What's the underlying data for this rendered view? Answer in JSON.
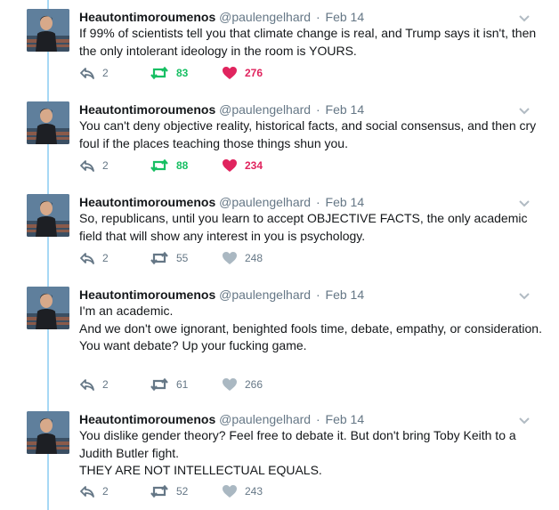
{
  "colors": {
    "thread_line": "#a7d8f5",
    "retweet_active": "#17bf63",
    "like_active": "#e0245e",
    "muted": "#657786"
  },
  "tweets": [
    {
      "name": "Heautontimoroumenos",
      "handle": "@paulengelhard",
      "sep": "·",
      "date": "Feb 14",
      "lines": [
        "If 99% of scientists tell you that climate change is real, and Trump says it isn't, then the only intolerant ideology in the room is YOURS."
      ],
      "replies": "2",
      "retweets": "83",
      "likes": "276",
      "retweeted": true,
      "liked": true
    },
    {
      "name": "Heautontimoroumenos",
      "handle": "@paulengelhard",
      "sep": "·",
      "date": "Feb 14",
      "lines": [
        "You can't deny objective reality, historical facts, and social consensus, and then cry foul if the places teaching those things shun you."
      ],
      "replies": "2",
      "retweets": "88",
      "likes": "234",
      "retweeted": true,
      "liked": true
    },
    {
      "name": "Heautontimoroumenos",
      "handle": "@paulengelhard",
      "sep": "·",
      "date": "Feb 14",
      "lines": [
        "So, republicans, until you learn to accept OBJECTIVE FACTS, the only academic field that will show any interest in you is psychology."
      ],
      "replies": "2",
      "retweets": "55",
      "likes": "248",
      "retweeted": false,
      "liked": false
    },
    {
      "name": "Heautontimoroumenos",
      "handle": "@paulengelhard",
      "sep": "·",
      "date": "Feb 14",
      "lines": [
        "I'm an academic.",
        "And we don't owe ignorant, benighted fools time, debate, empathy, or consideration.",
        "You want debate? Up your fucking game."
      ],
      "replies": "2",
      "retweets": "61",
      "likes": "266",
      "retweeted": false,
      "liked": false
    },
    {
      "name": "Heautontimoroumenos",
      "handle": "@paulengelhard",
      "sep": "·",
      "date": "Feb 14",
      "lines": [
        "You dislike gender theory? Feel free to debate it. But don't bring Toby Keith to a Judith Butler fight.",
        "THEY ARE NOT INTELLECTUAL EQUALS."
      ],
      "replies": "2",
      "retweets": "52",
      "likes": "243",
      "retweeted": false,
      "liked": false
    }
  ]
}
